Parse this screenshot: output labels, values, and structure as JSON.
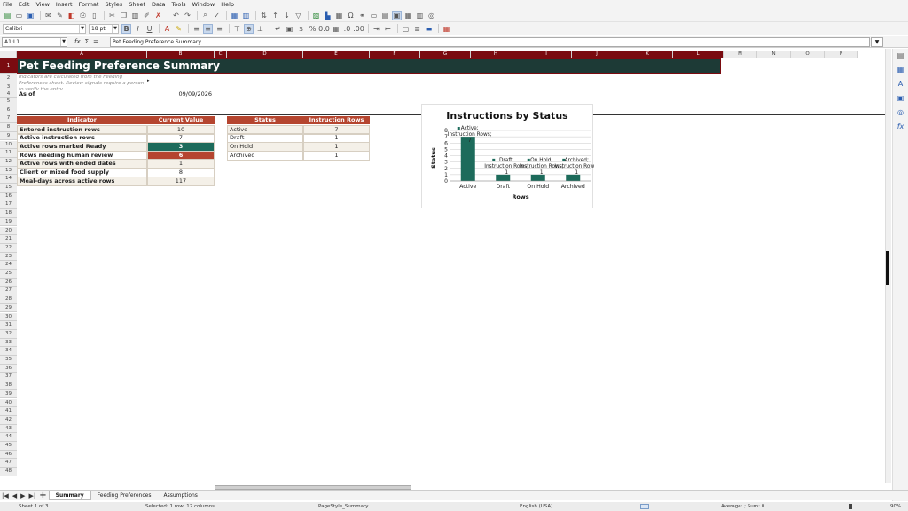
{
  "menu": [
    "File",
    "Edit",
    "View",
    "Insert",
    "Format",
    "Styles",
    "Sheet",
    "Data",
    "Tools",
    "Window",
    "Help"
  ],
  "font": {
    "name": "Calibri",
    "size": "18 pt"
  },
  "name_box": "A1:L1",
  "formula": "Pet Feeding Preference Summary",
  "columns": [
    "A",
    "B",
    "C",
    "D",
    "E",
    "F",
    "G",
    "H",
    "I",
    "J",
    "K",
    "L",
    "M",
    "N",
    "O",
    "P"
  ],
  "rows": [
    "1",
    "2",
    "3",
    "4",
    "5",
    "6",
    "7",
    "8",
    "9",
    "10",
    "11",
    "12",
    "13",
    "14",
    "15",
    "16",
    "17",
    "18",
    "19",
    "20",
    "21",
    "22",
    "23",
    "24",
    "25",
    "26",
    "27",
    "28",
    "29",
    "30",
    "31",
    "32",
    "33",
    "34",
    "35",
    "36",
    "37",
    "38",
    "39",
    "40",
    "41",
    "42",
    "43",
    "44",
    "45",
    "46",
    "47",
    "48"
  ],
  "sheet": {
    "title": "Pet Feeding Preference Summary",
    "note": "Indicators are calculated from the Feeding Preferences sheet. Review signals require a person to verify the entry.",
    "as_of_label": "As of",
    "as_of_value": "09/09/2026",
    "indicator_header": "Indicator",
    "value_header": "Current Value",
    "indicators": [
      {
        "label": "Entered instruction rows",
        "value": "10"
      },
      {
        "label": "Active instruction rows",
        "value": "7"
      },
      {
        "label": "Active rows marked Ready",
        "value": "3"
      },
      {
        "label": "Rows needing human review",
        "value": "6"
      },
      {
        "label": "Active rows with ended dates",
        "value": "1"
      },
      {
        "label": "Client or mixed food supply",
        "value": "8"
      },
      {
        "label": "Meal-days across active rows",
        "value": "117"
      }
    ],
    "status_header": "Status",
    "rows_header": "Instruction Rows",
    "statuses": [
      {
        "label": "Active",
        "value": "7"
      },
      {
        "label": "Draft",
        "value": "1"
      },
      {
        "label": "On Hold",
        "value": "1"
      },
      {
        "label": "Archived",
        "value": "1"
      }
    ]
  },
  "chart_data": {
    "type": "bar",
    "title": "Instructions by Status",
    "xlabel": "Rows",
    "ylabel": "Status",
    "categories": [
      "Active",
      "Draft",
      "On Hold",
      "Archived"
    ],
    "values": [
      7,
      1,
      1,
      1
    ],
    "data_labels": [
      "Active; Instruction Rows; 7",
      "Draft; Instruction Rows; 1",
      "On Hold; Instruction Rows; 1",
      "Archived; Instruction Rows; 1"
    ],
    "yticks": [
      "0",
      "1",
      "2",
      "3",
      "4",
      "5",
      "6",
      "7",
      "8"
    ],
    "ylim": [
      0,
      8
    ],
    "grid": true,
    "bar_color": "#1d6b5b"
  },
  "tabs": [
    "Summary",
    "Feeding Preferences",
    "Assumptions"
  ],
  "status": {
    "sheet": "Sheet 1 of 3",
    "selection": "Selected: 1 row, 12 columns",
    "page_style": "PageStyle_Summary",
    "language": "English (USA)",
    "sum": "Average: ; Sum: 0",
    "zoom": "90%"
  },
  "colors": {
    "title_bg": "#1d3a36",
    "header_bg": "#b5452f",
    "accent": "#7a0b10"
  }
}
